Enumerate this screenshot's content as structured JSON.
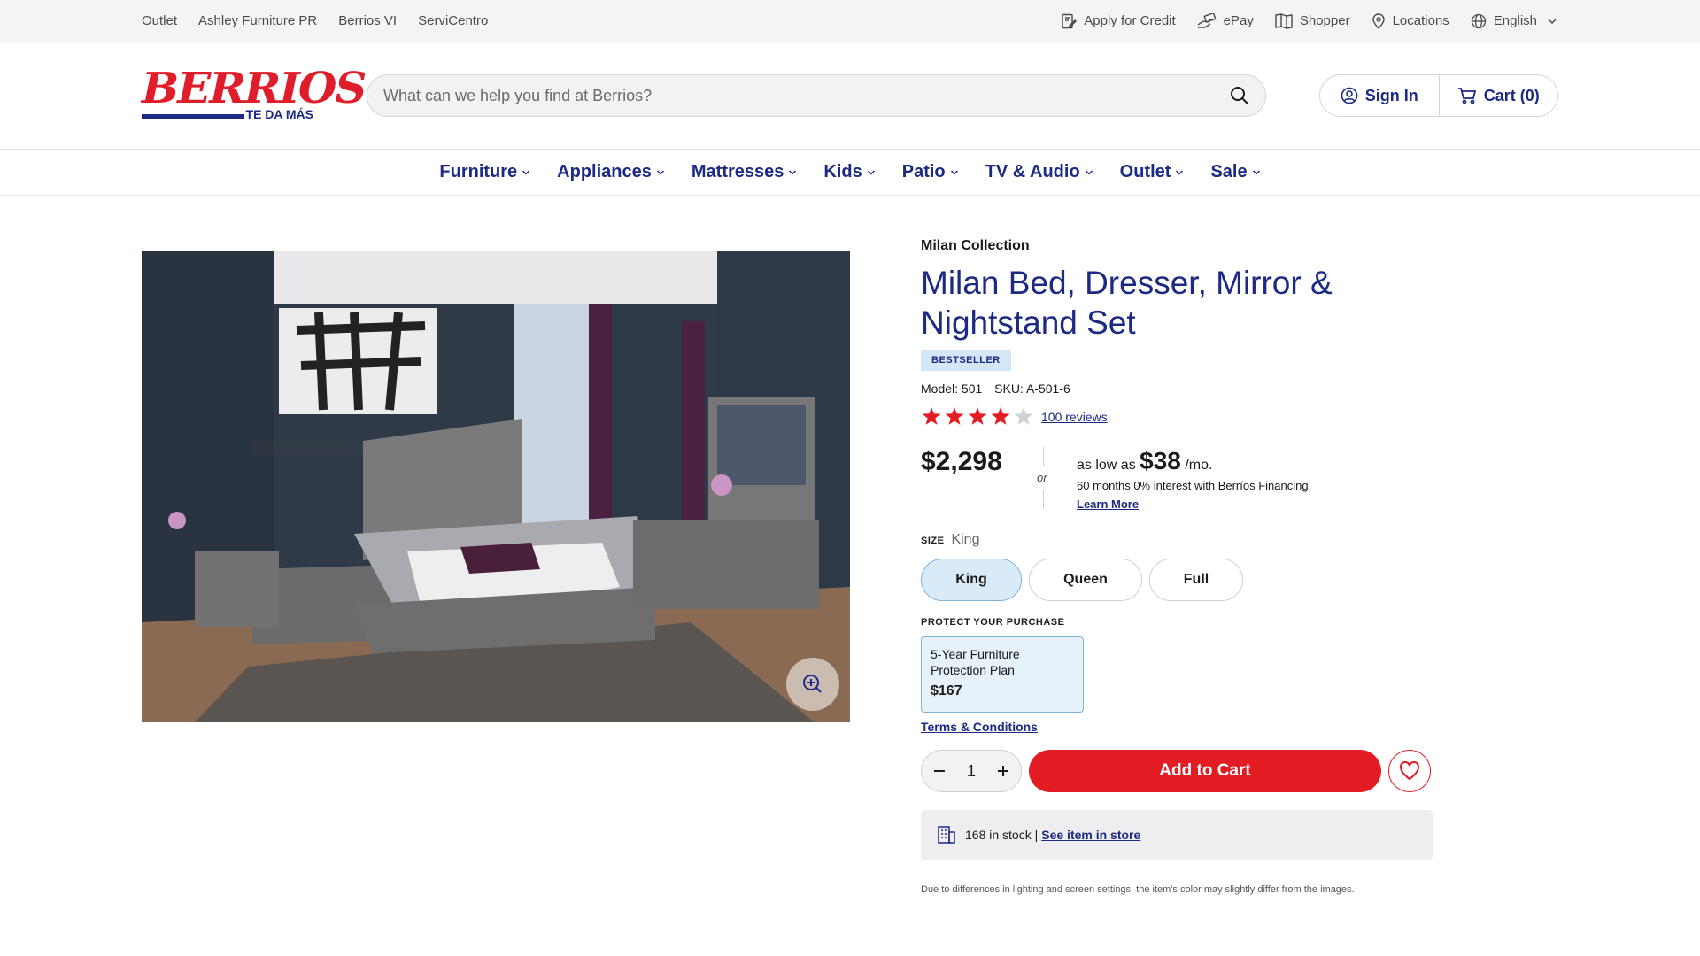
{
  "utility": {
    "left_links": [
      "Outlet",
      "Ashley Furniture PR",
      "Berrios VI",
      "ServiCentro"
    ],
    "apply_credit": "Apply for Credit",
    "epay": "ePay",
    "shopper": "Shopper",
    "locations": "Locations",
    "language": "English"
  },
  "header": {
    "logo_text": "BERRIOS",
    "logo_tagline": "TE DA MÁS",
    "search_placeholder": "What can we help you find at Berrios?",
    "sign_in": "Sign In",
    "cart": "Cart (0)"
  },
  "nav": [
    "Furniture",
    "Appliances",
    "Mattresses",
    "Kids",
    "Patio",
    "TV & Audio",
    "Outlet",
    "Sale"
  ],
  "product": {
    "collection": "Milan Collection",
    "title": "Milan Bed, Dresser, Mirror & Nightstand Set",
    "badge": "BESTSELLER",
    "model": "Model: 501",
    "sku": "SKU: A-501-6",
    "rating": 4,
    "rating_max": 5,
    "reviews": "100 reviews",
    "price": "$2,298",
    "or": "or",
    "fin_prefix": "as low as",
    "fin_amount": "$38",
    "fin_suffix": "/mo.",
    "fin_terms": "60 months 0% interest with Berríos Financing",
    "learn_more": "Learn More",
    "size_label": "SIZE",
    "size_selected": "King",
    "sizes": [
      "King",
      "Queen",
      "Full"
    ],
    "protect_label": "PROTECT YOUR PURCHASE",
    "plan_name": "5-Year Furniture Protection Plan",
    "plan_price": "$167",
    "terms": "Terms & Conditions",
    "qty": "1",
    "add_to_cart": "Add to Cart",
    "stock_text": "168 in stock |",
    "see_in_store": "See item in store",
    "disclaimer": "Due to differences in lighting and screen settings, the item's color may slightly differ from the images."
  },
  "colors": {
    "brand_blue": "#1c2a84",
    "brand_red": "#e31b23",
    "star_red": "#e31b23"
  }
}
